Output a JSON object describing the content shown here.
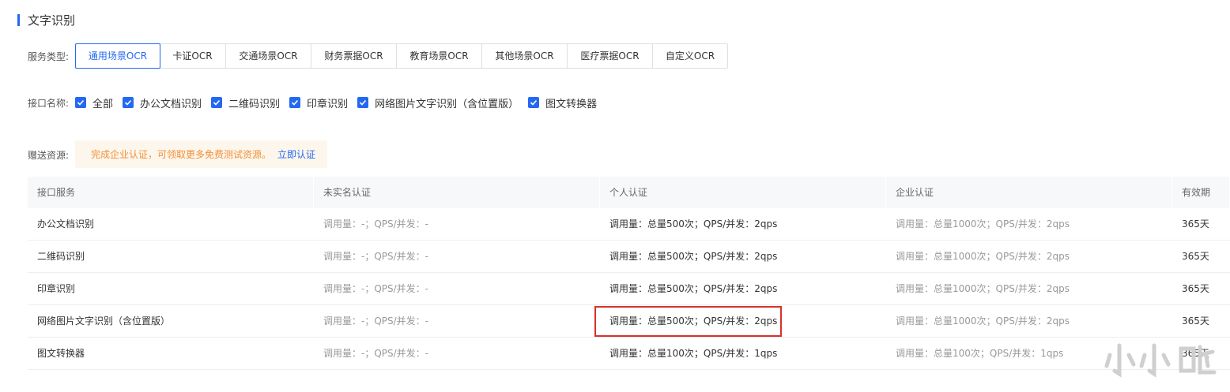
{
  "section": {
    "title": "文字识别"
  },
  "service_type": {
    "label": "服务类型:",
    "tabs": [
      "通用场景OCR",
      "卡证OCR",
      "交通场景OCR",
      "财务票据OCR",
      "教育场景OCR",
      "其他场景OCR",
      "医疗票据OCR",
      "自定义OCR"
    ],
    "active_index": 0
  },
  "interface": {
    "label": "接口名称:",
    "checkboxes": [
      "全部",
      "办公文档识别",
      "二维码识别",
      "印章识别",
      "网络图片文字识别（含位置版）",
      "图文转换器"
    ]
  },
  "gift": {
    "label": "赠送资源:",
    "message": "完成企业认证，可领取更多免费测试资源。",
    "link": "立即认证"
  },
  "table": {
    "headers": [
      "接口服务",
      "未实名认证",
      "个人认证",
      "企业认证",
      "有效期"
    ],
    "rows": [
      [
        "办公文档识别",
        "调用量：-；QPS/并发：-",
        "调用量：总量500次；QPS/并发：2qps",
        "调用量：总量1000次；QPS/并发：2qps",
        "365天"
      ],
      [
        "二维码识别",
        "调用量：-；QPS/并发：-",
        "调用量：总量500次；QPS/并发：2qps",
        "调用量：总量1000次；QPS/并发：2qps",
        "365天"
      ],
      [
        "印章识别",
        "调用量：-；QPS/并发：-",
        "调用量：总量500次；QPS/并发：2qps",
        "调用量：总量1000次；QPS/并发：2qps",
        "365天"
      ],
      [
        "网络图片文字识别（含位置版）",
        "调用量：-；QPS/并发：-",
        "调用量：总量500次；QPS/并发：2qps",
        "调用量：总量1000次；QPS/并发：2qps",
        "365天"
      ],
      [
        "图文转换器",
        "调用量：-；QPS/并发：-",
        "调用量：总量100次；QPS/并发：1qps",
        "调用量：总量100次；QPS/并发：1qps",
        "365天"
      ]
    ]
  },
  "colors": {
    "accent": "#2468f2",
    "warning_text": "#f0913a",
    "highlight": "#d9312b"
  }
}
